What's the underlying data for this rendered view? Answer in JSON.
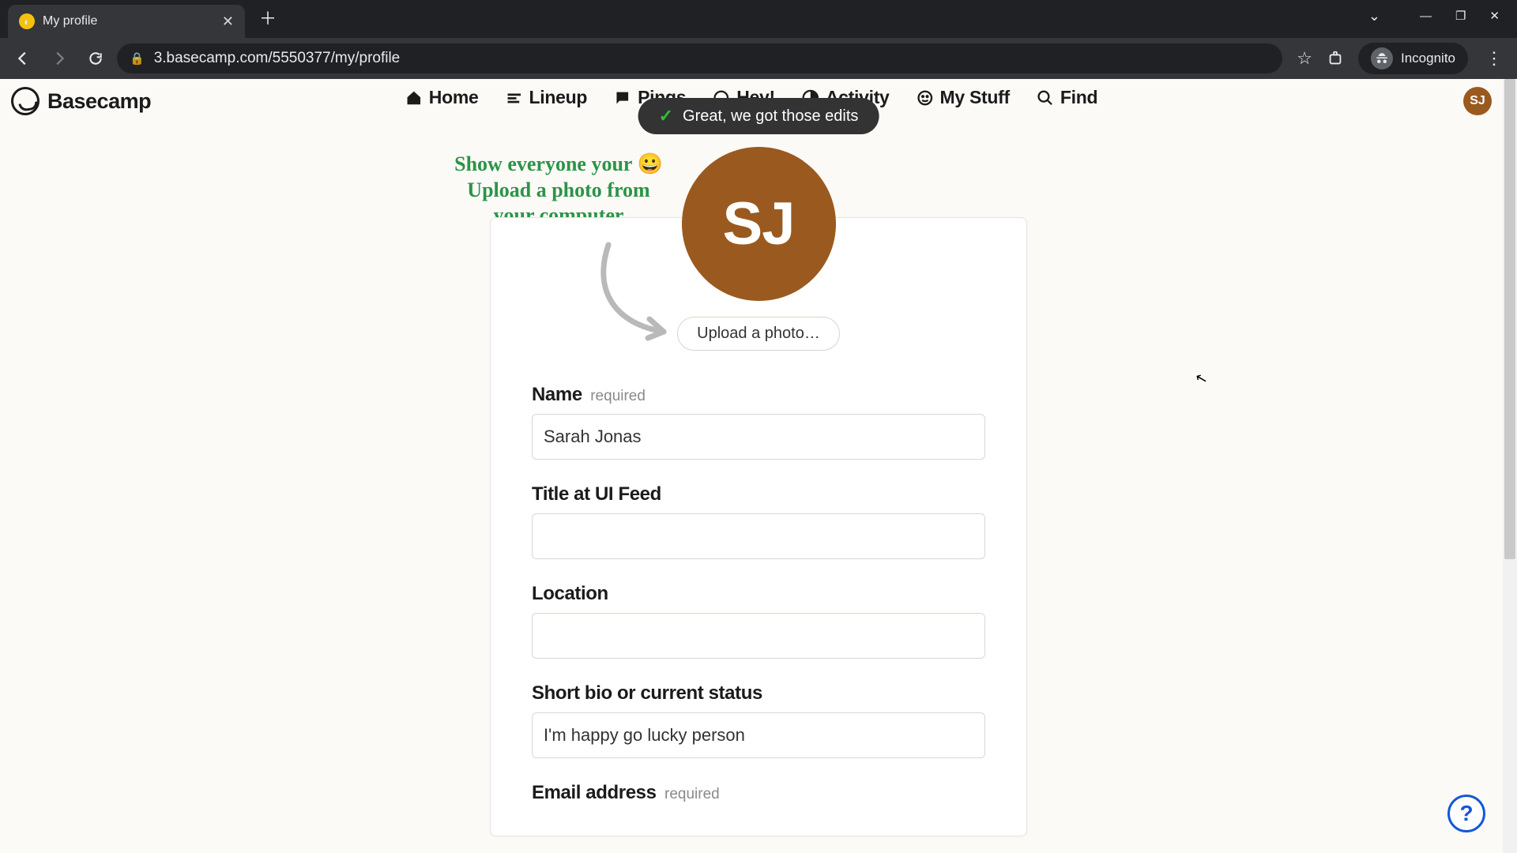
{
  "browser": {
    "tab_title": "My profile",
    "url": "3.basecamp.com/5550377/my/profile",
    "incognito_label": "Incognito"
  },
  "app": {
    "logo_text": "Basecamp",
    "nav": {
      "home": "Home",
      "lineup": "Lineup",
      "pings": "Pings",
      "hey": "Hey!",
      "activity": "Activity",
      "mystuff": "My Stuff",
      "find": "Find"
    },
    "avatar_initials": "SJ"
  },
  "toast": {
    "message": "Great, we got those edits"
  },
  "profile": {
    "callout_line1": "Show everyone your 😀",
    "callout_line2": "Upload a photo from",
    "callout_line3": "your computer",
    "avatar_initials": "SJ",
    "upload_button": "Upload a photo…",
    "labels": {
      "name": "Name",
      "name_req": "required",
      "title": "Title at UI Feed",
      "location": "Location",
      "bio": "Short bio or current status",
      "email": "Email address",
      "email_req": "required"
    },
    "values": {
      "name": "Sarah Jonas",
      "title": "",
      "location": "",
      "bio": "I'm happy go lucky person"
    }
  }
}
